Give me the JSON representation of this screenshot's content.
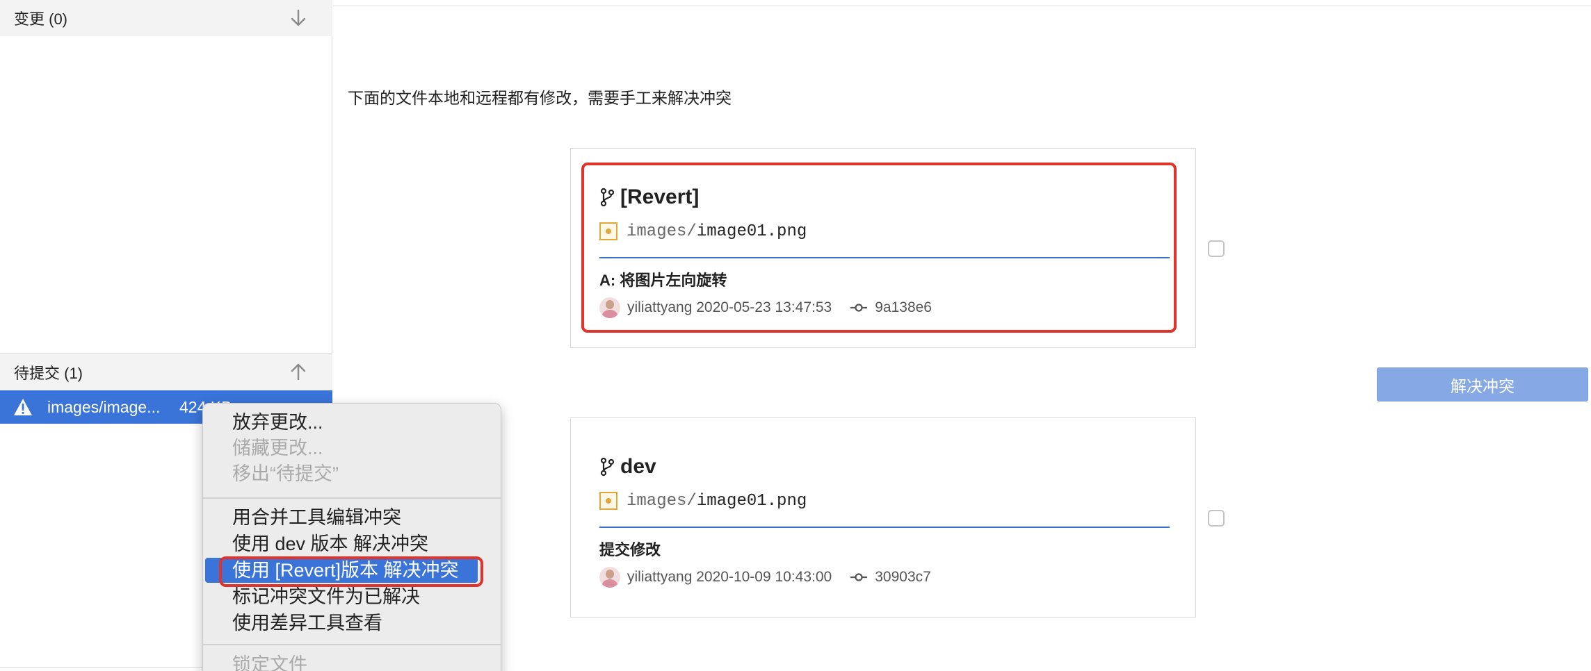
{
  "sidebar": {
    "changes_header": "变更 (0)",
    "pending_header": "待提交 (1)",
    "pending_files": [
      {
        "name": "images/image...",
        "size": "424 KB"
      }
    ]
  },
  "main": {
    "conflict_message": "下面的文件本地和远程都有修改，需要手工来解决冲突",
    "cards": [
      {
        "branch": "[Revert]",
        "file_dir": "images/",
        "file_base": "image01.png",
        "commit_message": "A: 将图片左向旋转",
        "author": "yiliattyang",
        "date": "2020-05-23 13:47:53",
        "hash": "9a138e6"
      },
      {
        "branch": "dev",
        "file_dir": "images/",
        "file_base": "image01.png",
        "commit_message": "提交修改",
        "author": "yiliattyang",
        "date": "2020-10-09 10:43:00",
        "hash": "30903c7"
      }
    ],
    "resolve_button": "解决冲突"
  },
  "context_menu": {
    "items": [
      {
        "label": "放弃更改...",
        "enabled": true
      },
      {
        "label": "储藏更改...",
        "enabled": false
      },
      {
        "label": "移出“待提交”",
        "enabled": false
      },
      {
        "label": "用合并工具编辑冲突",
        "enabled": true
      },
      {
        "label": "使用 dev 版本 解决冲突",
        "enabled": true
      },
      {
        "label": "使用 [Revert]版本 解决冲突",
        "enabled": true,
        "highlighted": true
      },
      {
        "label": "标记冲突文件为已解决",
        "enabled": true
      },
      {
        "label": "使用差异工具查看",
        "enabled": true
      },
      {
        "label": "锁定文件",
        "enabled": false
      }
    ]
  },
  "colors": {
    "accent": "#3a74d8",
    "annotation_red": "#e0332b",
    "button_disabled": "#86a9e6"
  }
}
